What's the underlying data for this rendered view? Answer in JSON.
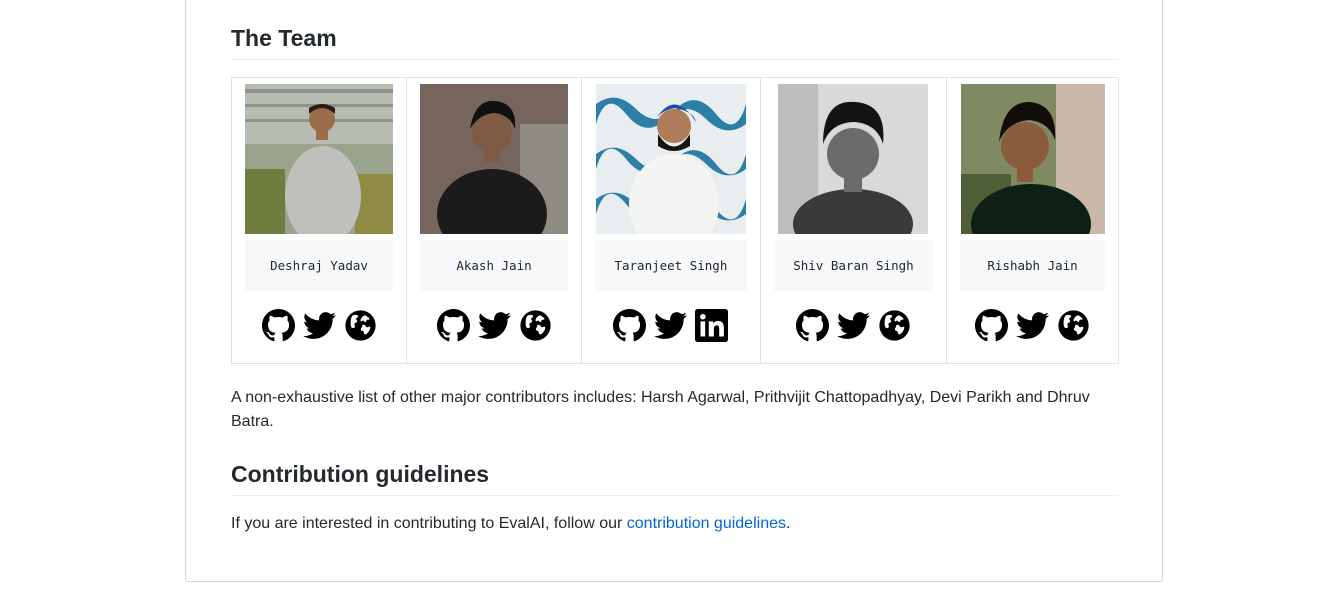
{
  "team_section": {
    "heading": "The Team",
    "members": [
      {
        "name": "Deshraj Yadav",
        "links": [
          "github-icon",
          "twitter-icon",
          "globe-icon"
        ]
      },
      {
        "name": "Akash Jain",
        "links": [
          "github-icon",
          "twitter-icon",
          "globe-icon"
        ]
      },
      {
        "name": "Taranjeet Singh",
        "links": [
          "github-icon",
          "twitter-icon",
          "linkedin-icon"
        ]
      },
      {
        "name": "Shiv Baran Singh",
        "links": [
          "github-icon",
          "twitter-icon",
          "globe-icon"
        ]
      },
      {
        "name": "Rishabh Jain",
        "links": [
          "github-icon",
          "twitter-icon",
          "globe-icon"
        ]
      }
    ],
    "contributors_text": "A non-exhaustive list of other major contributors includes: Harsh Agarwal, Prithvijit Chattopadhyay, Devi Parikh and Dhruv Batra."
  },
  "contribution_section": {
    "heading": "Contribution guidelines",
    "text_before": "If you are interested in contributing to EvalAI, follow our ",
    "link_text": "contribution guidelines",
    "text_after": "."
  },
  "colors": {
    "link": "#0366d6",
    "text": "#24292e",
    "border": "#dfe2e5",
    "name_bg": "#f6f8fa"
  }
}
